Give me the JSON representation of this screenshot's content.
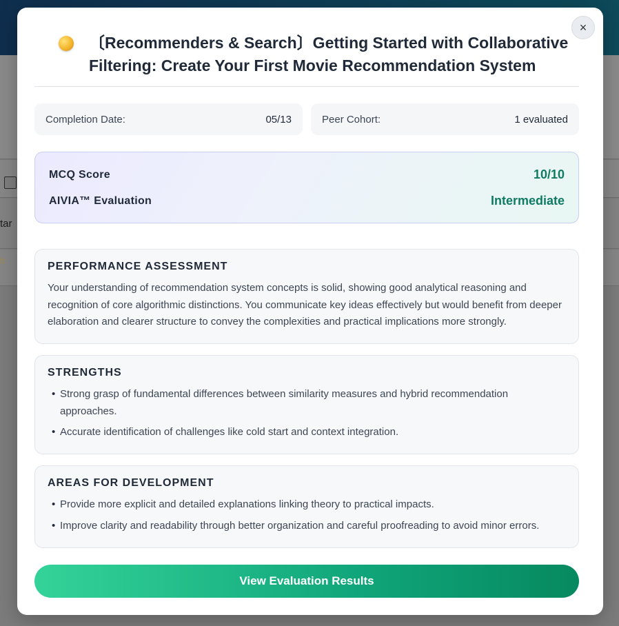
{
  "background": {
    "partial_text": "tar"
  },
  "modal": {
    "close_symbol": "×",
    "title": "〔Recommenders & Search〕Getting Started with Collaborative Filtering: Create Your First Movie Recommendation System",
    "info": {
      "completion_label": "Completion Date:",
      "completion_value": "05/13",
      "cohort_label": "Peer Cohort:",
      "cohort_value": "1 evaluated"
    },
    "scores": {
      "mcq_label": "MCQ Score",
      "mcq_value": "10/10",
      "aivia_label": "AIVIA™ Evaluation",
      "aivia_value": "Intermediate"
    },
    "performance": {
      "title": "PERFORMANCE ASSESSMENT",
      "body": "Your understanding of recommendation system concepts is solid, showing good analytical reasoning and recognition of core algorithmic distinctions. You communicate key ideas effectively but would benefit from deeper elaboration and clearer structure to convey the complexities and practical implications more strongly."
    },
    "strengths": {
      "title": "STRENGTHS",
      "items": [
        "Strong grasp of fundamental differences between similarity measures and hybrid recommendation approaches.",
        "Accurate identification of challenges like cold start and context integration."
      ]
    },
    "development": {
      "title": "AREAS FOR DEVELOPMENT",
      "items": [
        "Provide more explicit and detailed explanations linking theory to practical impacts.",
        "Improve clarity and readability through better organization and careful proofreading to avoid minor errors."
      ]
    },
    "cta_label": "View Evaluation Results"
  },
  "colors": {
    "accent_green": "#117a63",
    "button_gradient_start": "#34d399",
    "button_gradient_end": "#07895f",
    "header_bar": "#0f2e4e"
  },
  "icons": {
    "title_icon": "gold-coin-icon",
    "close_icon": "close-icon",
    "star_icon": "star-icon"
  }
}
